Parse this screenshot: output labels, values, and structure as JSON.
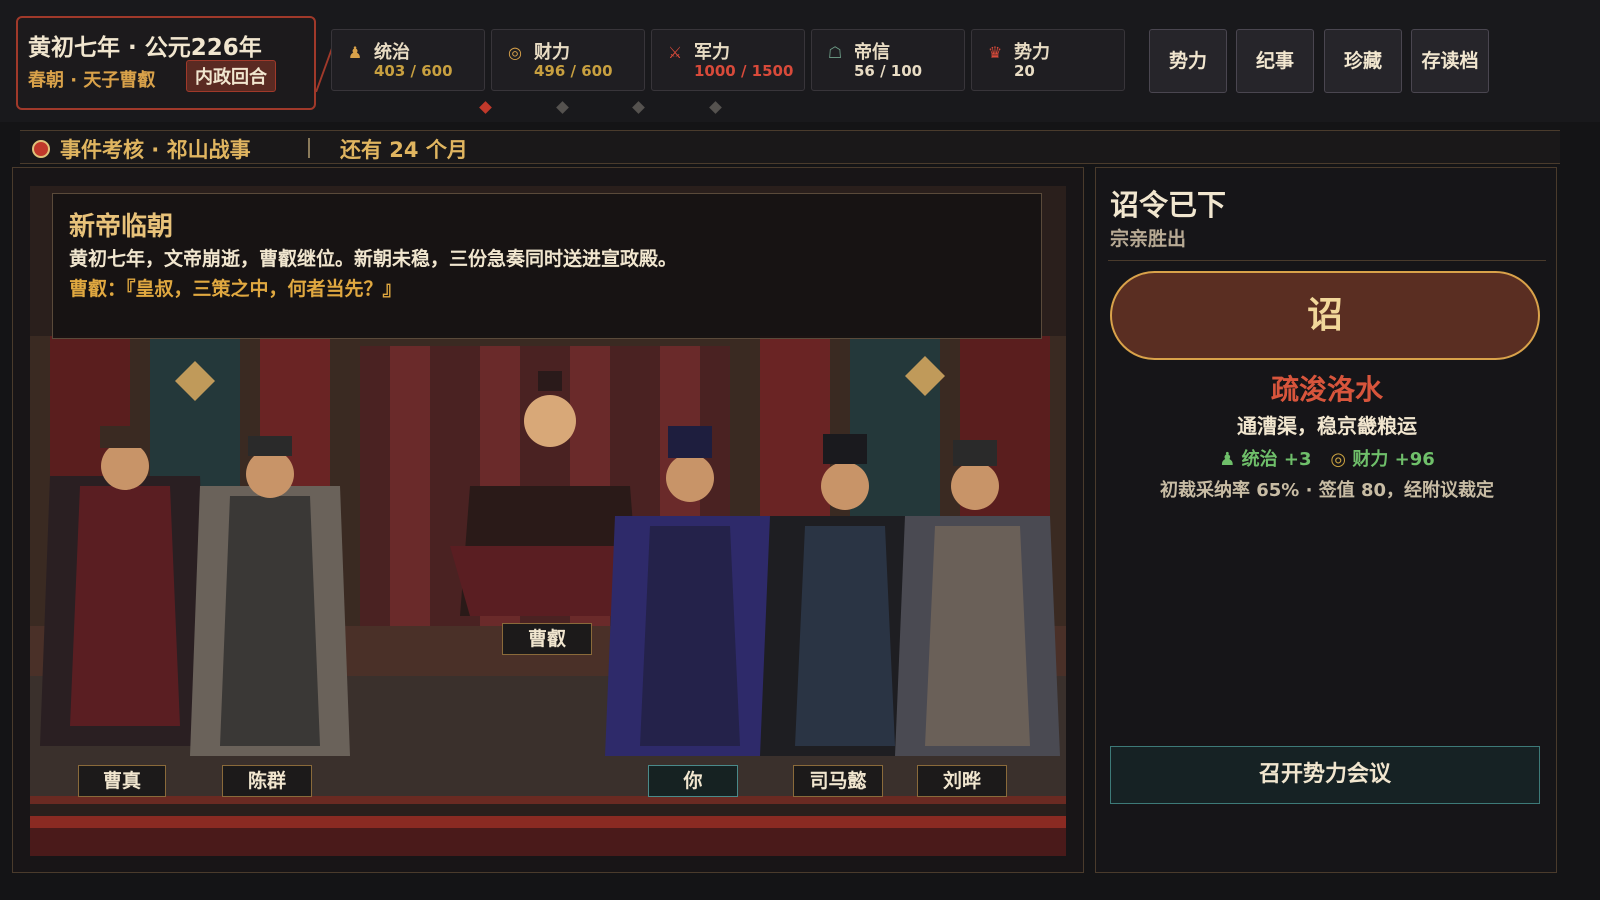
{
  "header": {
    "date_main": "黄初七年 · 公元226年",
    "date_sub": "春朝 · 天子曹叡",
    "phase": "内政回合"
  },
  "stats": [
    {
      "name": "统治",
      "value": "403 / 600",
      "icon": "people-icon",
      "color": "#c8a040"
    },
    {
      "name": "财力",
      "value": "496 / 600",
      "icon": "coins-icon",
      "color": "#c8a040"
    },
    {
      "name": "军力",
      "value": "1000 / 1500",
      "icon": "crossed-swords-icon",
      "color": "#d84a3a"
    },
    {
      "name": "帝信",
      "value": "56 / 100",
      "icon": "handshake-icon",
      "color": "#e8dcc4"
    },
    {
      "name": "势力",
      "value": "20",
      "icon": "crown-icon",
      "color": "#e8dcc4"
    }
  ],
  "menu": {
    "faction": "势力",
    "chronicle": "纪事",
    "treasures": "珍藏",
    "save_load": "存读档"
  },
  "event": {
    "title": "事件考核 · 祁山战事",
    "remaining": "还有 24 个月"
  },
  "narration": {
    "title": "新帝临朝",
    "body": "黄初七年，文帝崩逝，曹叡继位。新朝未稳，三份急奏同时送进宣政殿。",
    "quote": "曹叡：『皇叔，三策之中，何者当先？』"
  },
  "characters": {
    "emperor": "曹叡",
    "c1": "曹真",
    "c2": "陈群",
    "you": "你",
    "c4": "司马懿",
    "c5": "刘晔"
  },
  "decree": {
    "title": "诏令已下",
    "subtitle": "宗亲胜出",
    "button": "诏",
    "policy_name": "疏浚洛水",
    "policy_desc": "通漕渠，稳京畿粮运",
    "effect1": "统治 +3",
    "effect2": "财力 +96",
    "note": "初裁采纳率 65% · 签值 80，经附议裁定",
    "council": "召开势力会议"
  },
  "colors": {
    "accent_red": "#a0392a",
    "gold": "#d9a24a",
    "positive_green": "#6fbf6a",
    "teal_border": "#3d7a78"
  }
}
